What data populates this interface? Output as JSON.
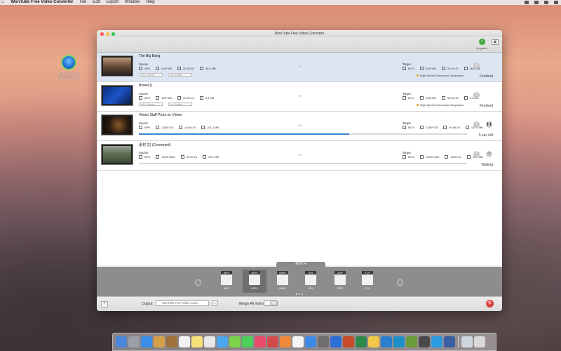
{
  "menubar": {
    "app": "WonTube Free Video Converter",
    "items": [
      "File",
      "Edit",
      "Export",
      "Window",
      "Help"
    ]
  },
  "desktop": {
    "icon_label": "WonTube Free Video Converter"
  },
  "window": {
    "title": "WonTube Free Video Converter",
    "upgrade_label": "Upgrade"
  },
  "rows": [
    {
      "title": "The Big Bang",
      "source_label": "Source",
      "source": {
        "format": "MP4",
        "resolution": "640*480",
        "duration": "00:04:30",
        "size": "36.8 MB"
      },
      "target_label": "Target",
      "target": {
        "format": "MOV",
        "resolution": "640*480",
        "duration": "00:04:30",
        "size": "36.8 MB"
      },
      "audio": "AAC, Stereo",
      "subtitle": "No Subtitle",
      "hsc": "High Speed Conversion Supported",
      "status": "Finished"
    },
    {
      "title": "Brave(1)",
      "source_label": "Source",
      "source": {
        "format": "MP4",
        "resolution": "428*320",
        "duration": "00:00:18",
        "size": "3.3 MB"
      },
      "target_label": "Target",
      "target": {
        "format": "MOV",
        "resolution": "428*320",
        "duration": "00:00:18",
        "size": "3.3 MB"
      },
      "audio": "AAC, Stereo",
      "subtitle": "No Subtitle",
      "hsc": "High Speed Conversion Supported",
      "status": "Finished"
    },
    {
      "title": "Vimeo Staff Picks on Vimeo",
      "source_label": "Source",
      "source": {
        "format": "MP4",
        "resolution": "1280*720",
        "duration": "00:06:30",
        "size": "101.3 MB"
      },
      "target_label": "Target",
      "target": {
        "format": "MOV",
        "resolution": "1280*720",
        "duration": "00:06:30",
        "size": "101.3 MB"
      },
      "status": "5 sec left",
      "progress": 0.64
    },
    {
      "title": "素材 (2) (Converted)",
      "source_label": "Source",
      "source": {
        "format": "MP4",
        "resolution": "1920*1080",
        "duration": "00:00:21",
        "size": "26.1 MB"
      },
      "target_label": "Target",
      "target": {
        "format": "MOV",
        "resolution": "1920*1080",
        "duration": "00:00:21",
        "size": "26.1 MB"
      },
      "status": "Waiting",
      "progress": 0
    }
  ],
  "format_bar": {
    "selected": "MOV",
    "items": [
      {
        "tag": "MP4",
        "label": "MP4"
      },
      {
        "tag": "MOV",
        "label": "MOV"
      },
      {
        "tag": "WMV",
        "label": "WMV"
      },
      {
        "tag": "AVI",
        "label": "AVI"
      },
      {
        "tag": "3GP",
        "label": "3GP"
      },
      {
        "tag": "FLV",
        "label": "FLV"
      }
    ]
  },
  "bottom": {
    "output_label": "Output:",
    "output_value": "WonTube Free Video Conv...",
    "merge_label": "Merge All Videos:",
    "toggle_state": "Off"
  }
}
